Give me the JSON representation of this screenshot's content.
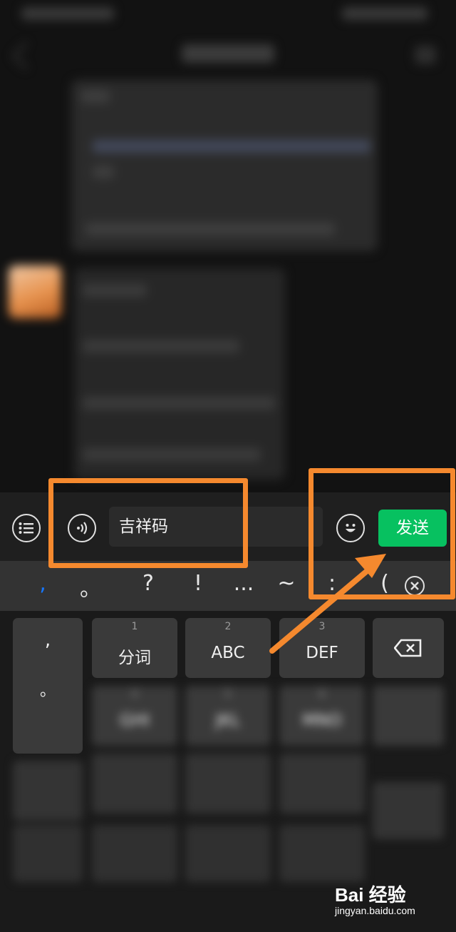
{
  "input": {
    "text": "吉祥码",
    "send_label": "发送"
  },
  "punctuation": [
    ",",
    "。",
    "?",
    "!",
    "...",
    "~",
    ":",
    "("
  ],
  "keyboard": {
    "row1": [
      {
        "num": "",
        "label": ","
      },
      {
        "num": "1",
        "label": "分词"
      },
      {
        "num": "2",
        "label": "ABC"
      },
      {
        "num": "3",
        "label": "DEF"
      }
    ],
    "row2": [
      {
        "num": "4",
        "label": "GHI"
      },
      {
        "num": "5",
        "label": "JKL"
      },
      {
        "num": "6",
        "label": "MNO"
      }
    ],
    "side_left_2": "。"
  },
  "watermark": {
    "logo": "Bai 经验",
    "url": "jingyan.baidu.com"
  },
  "colors": {
    "send_green": "#07c160",
    "annotation_orange": "#f5892e",
    "accent_blue": "#1677ff"
  }
}
